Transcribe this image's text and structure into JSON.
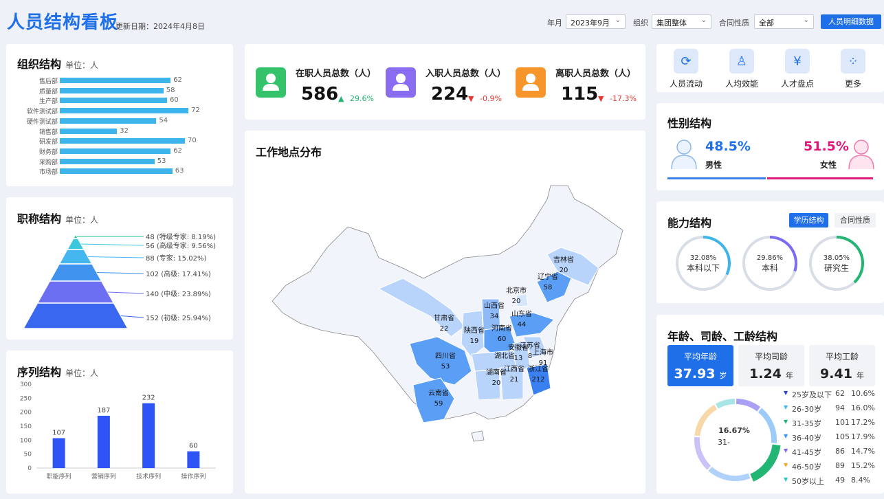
{
  "header": {
    "title": "人员结构看板",
    "update": "更新日期：2024年4月8日",
    "filters": [
      {
        "label": "年月",
        "value": "2023年9月"
      },
      {
        "label": "组织",
        "value": "集团整体"
      },
      {
        "label": "合同性质",
        "value": "全部"
      }
    ],
    "detail_button": "人员明细数据"
  },
  "org": {
    "title": "组织结构",
    "unit": "单位：人",
    "rows": [
      {
        "label": "售后部",
        "value": 62
      },
      {
        "label": "质量部",
        "value": 58
      },
      {
        "label": "生产部",
        "value": 60
      },
      {
        "label": "软件测试部",
        "value": 72
      },
      {
        "label": "硬件测试部",
        "value": 54
      },
      {
        "label": "销售部",
        "value": 32
      },
      {
        "label": "研发部",
        "value": 70
      },
      {
        "label": "财务部",
        "value": 62
      },
      {
        "label": "采购部",
        "value": 53
      },
      {
        "label": "市场部",
        "value": 63
      }
    ]
  },
  "title_rank": {
    "title": "职称结构",
    "unit": "单位：人",
    "levels": [
      {
        "text": "48 (特级专家: 8.19%)",
        "color": "#1fc08e"
      },
      {
        "text": "56 (高级专家: 9.56%)",
        "color": "#3cc8dc"
      },
      {
        "text": "88 (专家: 15.02%)",
        "color": "#45b6f0"
      },
      {
        "text": "102 (高级: 17.41%)",
        "color": "#3f93ef"
      },
      {
        "text": "140 (中级: 23.89%)",
        "color": "#6c6ff2"
      },
      {
        "text": "152 (初级: 25.94%)",
        "color": "#3a67f0"
      }
    ]
  },
  "sequence": {
    "title": "序列结构",
    "unit": "单位：人",
    "chart_data": {
      "type": "bar",
      "categories": [
        "职能序列",
        "营销序列",
        "技术序列",
        "操作序列"
      ],
      "values": [
        107,
        187,
        232,
        60
      ],
      "ylim": [
        0,
        300
      ],
      "yticks": [
        0,
        50,
        100,
        150,
        200,
        250,
        300
      ],
      "color": "#2f54f5"
    }
  },
  "kpis": [
    {
      "label": "在职人员总数（人）",
      "value": "586",
      "change": "29.6%",
      "dir": "up",
      "color": "#34c26b",
      "icon": "person-icon"
    },
    {
      "label": "入职人员总数（人）",
      "value": "224",
      "change": "-0.9%",
      "dir": "down",
      "color": "#8a6cf0",
      "icon": "person-add-icon"
    },
    {
      "label": "离职人员总数（人）",
      "value": "115",
      "change": "-17.3%",
      "dir": "down",
      "color": "#f5952a",
      "icon": "person-remove-icon"
    }
  ],
  "map": {
    "title": "工作地点分布",
    "provinces": [
      {
        "name": "吉林省",
        "value": "20"
      },
      {
        "name": "辽宁省",
        "value": "58"
      },
      {
        "name": "北京市",
        "value": "20"
      },
      {
        "name": "山西省",
        "value": "34"
      },
      {
        "name": "山东省",
        "value": "44"
      },
      {
        "name": "甘肃省",
        "value": "22"
      },
      {
        "name": "陕西省",
        "value": "19"
      },
      {
        "name": "河南省",
        "value": "60"
      },
      {
        "name": "安徽省",
        "value": "13"
      },
      {
        "name": "江苏省",
        "value": "8"
      },
      {
        "name": "上海市",
        "value": "91"
      },
      {
        "name": "四川省",
        "value": "53"
      },
      {
        "name": "湖北省",
        "value": ""
      },
      {
        "name": "浙江省",
        "value": "212"
      },
      {
        "name": "湖南省",
        "value": "20"
      },
      {
        "name": "江西省",
        "value": "21"
      },
      {
        "name": "云南省",
        "value": "59"
      }
    ]
  },
  "quick": [
    {
      "label": "人员流动",
      "icon": "refresh-icon"
    },
    {
      "label": "人均效能",
      "icon": "user-badge-icon"
    },
    {
      "label": "人才盘点",
      "icon": "yen-icon"
    },
    {
      "label": "更多",
      "icon": "grid-icon"
    }
  ],
  "gender": {
    "title": "性别结构",
    "male_pct": "48.5%",
    "male_label": "男性",
    "female_pct": "51.5%",
    "female_label": "女性",
    "male_fraction": 0.485
  },
  "ability": {
    "title": "能力结构",
    "tabs": [
      "学历结构",
      "合同性质"
    ],
    "rings": [
      {
        "pct": "32.08%",
        "label": "本科以下",
        "fraction": 0.3208,
        "color": "#3db4ea"
      },
      {
        "pct": "29.86%",
        "label": "本科",
        "fraction": 0.2986,
        "color": "#7b6cf2"
      },
      {
        "pct": "38.05%",
        "label": "研究生",
        "fraction": 0.3805,
        "color": "#22b573"
      }
    ]
  },
  "age": {
    "title": "年龄、司龄、工龄结构",
    "avgs": [
      {
        "label": "平均年龄",
        "value": "37.93",
        "unit": "岁"
      },
      {
        "label": "平均司龄",
        "value": "1.24",
        "unit": "年"
      },
      {
        "label": "平均工龄",
        "value": "9.41",
        "unit": "年"
      }
    ],
    "donut_center_pct": "16.67%",
    "donut_center_label": "31-",
    "chart_data": {
      "type": "pie",
      "labels": [
        "25岁及以下",
        "26-30岁",
        "31-35岁",
        "36-40岁",
        "41-45岁",
        "46-50岁",
        "50岁以上"
      ],
      "values": [
        62,
        94,
        101,
        105,
        86,
        89,
        49
      ],
      "pcts": [
        "10.6%",
        "16.0%",
        "17.2%",
        "17.9%",
        "14.7%",
        "15.2%",
        "8.4%"
      ],
      "colors": [
        "#2b3fd6",
        "#45b6f0",
        "#22b573",
        "#3f93ef",
        "#7b6cf2",
        "#f5a623",
        "#2bc4c4"
      ]
    }
  }
}
